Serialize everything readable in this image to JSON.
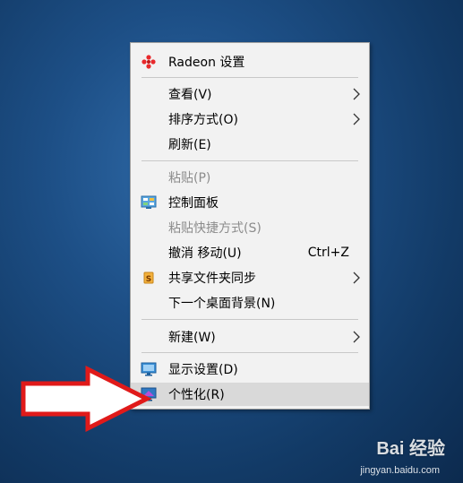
{
  "menu": {
    "items": [
      {
        "label": "Radeon 设置",
        "icon": "radeon-icon",
        "enabled": true
      },
      {
        "label": "查看(V)",
        "submenu": true,
        "enabled": true
      },
      {
        "label": "排序方式(O)",
        "submenu": true,
        "enabled": true
      },
      {
        "label": "刷新(E)",
        "enabled": true
      },
      {
        "label": "粘贴(P)",
        "enabled": false
      },
      {
        "label": "控制面板",
        "icon": "control-panel-icon",
        "enabled": true
      },
      {
        "label": "粘贴快捷方式(S)",
        "enabled": false
      },
      {
        "label": "撤消 移动(U)",
        "shortcut": "Ctrl+Z",
        "enabled": true
      },
      {
        "label": "共享文件夹同步",
        "icon": "share-sync-icon",
        "submenu": true,
        "enabled": true
      },
      {
        "label": "下一个桌面背景(N)",
        "enabled": true
      },
      {
        "label": "新建(W)",
        "submenu": true,
        "enabled": true
      },
      {
        "label": "显示设置(D)",
        "icon": "display-icon",
        "enabled": true
      },
      {
        "label": "个性化(R)",
        "icon": "personalize-icon",
        "enabled": true,
        "highlighted": true
      }
    ]
  },
  "watermark": {
    "text": "Bai 经验",
    "url": "jingyan.baidu.com"
  },
  "colors": {
    "accent_red": "#e8282b",
    "menu_bg": "#f2f2f2",
    "hover_bg": "#d9d9d9"
  }
}
